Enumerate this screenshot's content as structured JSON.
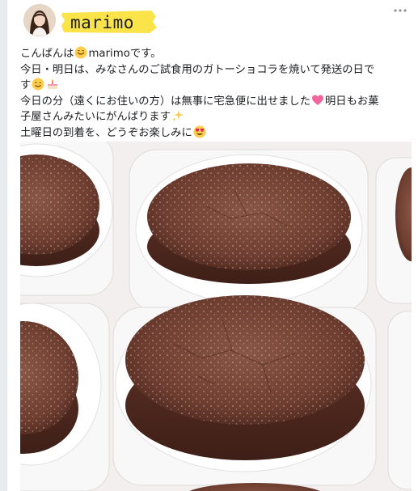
{
  "post": {
    "author_name": "marimo",
    "more_icon": "more-options-icon",
    "lines": [
      {
        "parts": [
          "こんばんは",
          "marimoです。"
        ],
        "emoji": "smiling-face-emoji"
      },
      {
        "text": "今日・明日は、みなさんのご試食用のガトーショコラを焼いて発送の日で"
      },
      {
        "parts": [
          "す",
          ""
        ],
        "emoji": [
          "winking-face-emoji",
          "cake-emoji"
        ]
      },
      {
        "parts": [
          "今日の分（遠くにお住いの方）は無事に宅急便に出せました",
          "明日もお菓"
        ],
        "emoji": "heart-emoji"
      },
      {
        "parts": [
          "子屋さんみたいにがんばります",
          ""
        ],
        "emoji": "sparkles-emoji"
      },
      {
        "parts": [
          "土曜日の到着を、どうぞお楽しみに",
          ""
        ],
        "emoji": "heart-eyes-emoji"
      }
    ],
    "photo": "gateau-chocolat-photo"
  },
  "colors": {
    "highlight": "#fbe34a",
    "text": "#1c1e21",
    "cake": "#6b3a2c"
  }
}
